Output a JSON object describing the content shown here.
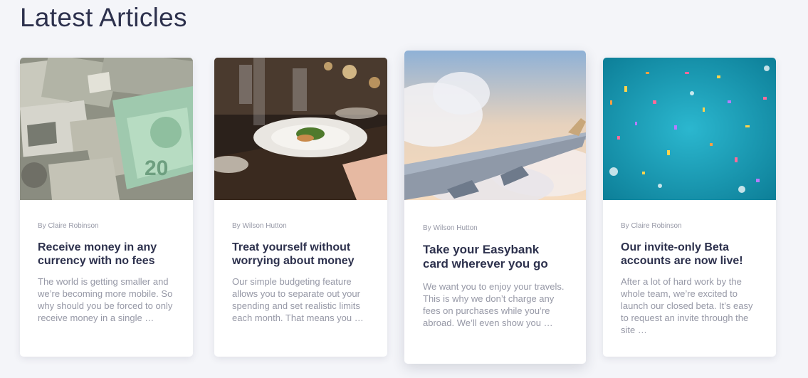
{
  "section": {
    "title": "Latest Articles"
  },
  "articles": [
    {
      "image": "money-pile-photo",
      "author": "By Claire Robinson",
      "title": "Receive money in any currency with no fees",
      "excerpt": "The world is getting smaller and we’re becoming more mobile. So why should you be forced to only receive money in a single …"
    },
    {
      "image": "restaurant-dinner-photo",
      "author": "By Wilson Hutton",
      "title": "Treat yourself without worrying about money",
      "excerpt": "Our simple budgeting feature allows you to separate out your spending and set realistic limits each month. That means you …"
    },
    {
      "image": "airplane-wing-clouds-photo",
      "author": "By Wilson Hutton",
      "title": "Take your Easybank card wherever you go",
      "excerpt": "We want you to enjoy your travels. This is why we don’t charge any fees on purchases while you’re abroad. We’ll even show you …"
    },
    {
      "image": "confetti-photo",
      "author": "By Claire Robinson",
      "title": "Our invite-only Beta accounts are now live!",
      "excerpt": "After a lot of hard work by the whole team, we’re excited to launch our closed beta. It’s easy to request an invite through the site …"
    }
  ],
  "colors": {
    "background": "#f4f5f9",
    "heading": "#2d314d",
    "muted": "#9698a6",
    "card": "#ffffff"
  }
}
